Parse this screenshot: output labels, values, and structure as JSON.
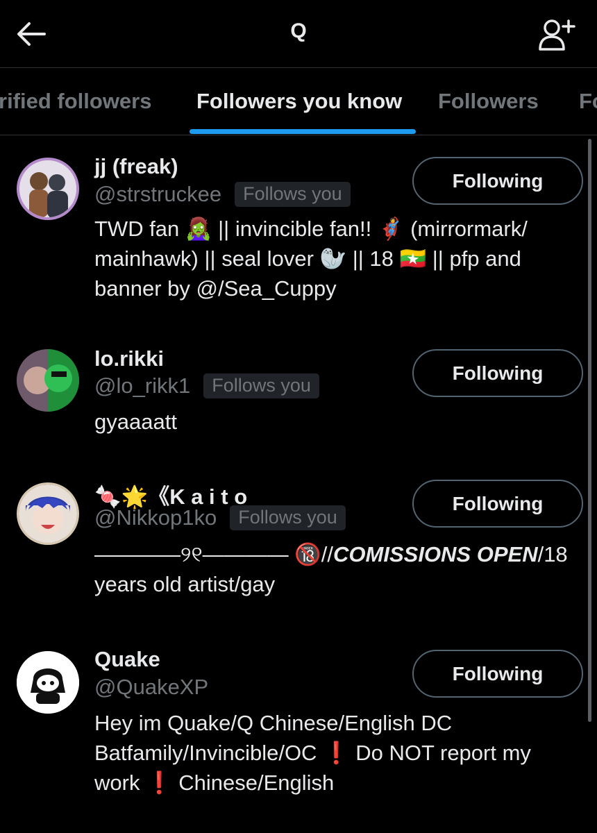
{
  "header": {
    "title": "Q",
    "back_icon": "back-arrow-icon",
    "add_icon": "add-user-icon"
  },
  "tabs": [
    {
      "label": "rified followers",
      "active": false
    },
    {
      "label": "Followers you know",
      "active": true
    },
    {
      "label": "Followers",
      "active": false
    },
    {
      "label": "Fo",
      "active": false
    }
  ],
  "accent_color": "#1d9bf0",
  "users": [
    {
      "name": "jj (freak)",
      "handle": "@strstruckee",
      "badge": "Follows you",
      "button": "Following",
      "bio_1": "TWD fan 🧟‍♀️ || invincible fan!! 🦸 (mirrormark/",
      "bio_2": "mainhawk) || seal lover 🦭 || 18 🇲🇲 || pfp and",
      "bio_3": "banner by @/Sea_Cuppy"
    },
    {
      "name": "lo.rikki",
      "handle": "@lo_rikk1",
      "badge": "Follows you",
      "button": "Following",
      "bio_1": "gyaaaatt"
    },
    {
      "name": "🍬🌟《K a i t o",
      "handle": "@Nikkop1ko",
      "badge": "Follows you",
      "button": "Following",
      "bio_1a": "————୨୧———— 🔞//",
      "bio_1b": "COMISSIONS OPEN",
      "bio_1c": "/18",
      "bio_2": "years old artist/gay"
    },
    {
      "name": "Quake",
      "handle": "@QuakeXP",
      "button": "Following",
      "bio_1": "Hey im Quake/Q Chinese/English DC",
      "bio_2": "Batfamily/Invincible/OC ❗ Do NOT report my",
      "bio_3": "work ❗ Chinese/English"
    }
  ]
}
